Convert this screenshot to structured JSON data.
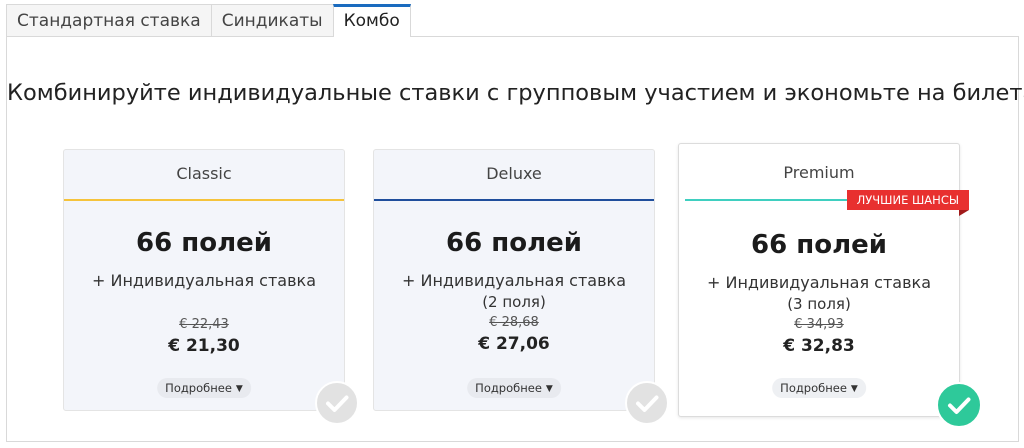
{
  "tabs": [
    {
      "label": "Стандартная ставка",
      "active": false
    },
    {
      "label": "Синдикаты",
      "active": false
    },
    {
      "label": "Комбо",
      "active": true
    }
  ],
  "headline": "Комбинируйте индивидуальные ставки с групповым участием и экономьте на билетах!",
  "cards": [
    {
      "name": "Classic",
      "accent": "#f5c33b",
      "fields": "66 полей",
      "addon": "+ Индивидуальная ставка",
      "addon_detail": "",
      "old_price": "€ 22,43",
      "new_price": "€ 21,30",
      "more_label": "Подробнее",
      "selected": false
    },
    {
      "name": "Deluxe",
      "accent": "#1f4e9c",
      "fields": "66 полей",
      "addon": "+ Индивидуальная ставка",
      "addon_detail": "(2 поля)",
      "old_price": "€ 28,68",
      "new_price": "€ 27,06",
      "more_label": "Подробнее",
      "selected": false
    },
    {
      "name": "Premium",
      "accent": "#3fcfc0",
      "badge": "ЛУЧШИЕ ШАНСЫ",
      "badge_color": "#e8302f",
      "fields": "66 полей",
      "addon": "+ Индивидуальная ставка",
      "addon_detail": "(3 поля)",
      "old_price": "€ 34,93",
      "new_price": "€ 32,83",
      "more_label": "Подробнее",
      "selected": true
    }
  ],
  "icons": {
    "check": "check-circle-icon",
    "caret": "caret-down-icon"
  },
  "colors": {
    "active_tab": "#1a6bbf",
    "selected_check": "#2ec99a",
    "unselected_check": "#e2e2e2"
  }
}
